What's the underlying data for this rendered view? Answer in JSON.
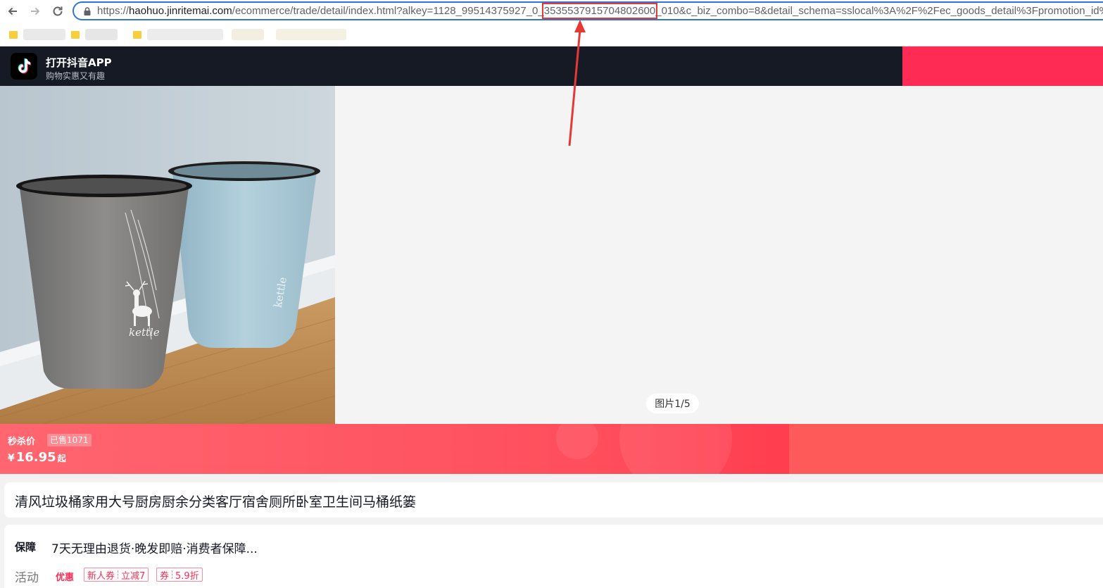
{
  "browser": {
    "url_prefix": "https://",
    "url_host": "haohuo.jinritemai.com",
    "url_path_before": "/ecommerce/trade/detail/index.html?alkey=1128_99514375927_0_",
    "url_highlight": "3535537915704802600",
    "url_path_after": "_010&c_biz_combo=8&detail_schema=sslocal%3A%2F%2Fec_goods_detail%3Fpromotion_id%"
  },
  "app_header": {
    "title": "打开抖音APP",
    "subtitle": "购物实惠又有趣"
  },
  "gallery": {
    "counter": "图片1/5",
    "product_image_text": "kettle"
  },
  "price_banner": {
    "label": "秒杀价",
    "sold": "已售1071",
    "currency": "¥",
    "price": "16.95",
    "suffix": "起"
  },
  "product": {
    "title": "清风垃圾桶家用大号厨房厨余分类客厅宿舍厕所卧室卫生间马桶纸篓"
  },
  "guarantee": {
    "label": "保障",
    "text": "7天无理由退货·晚发即赔·消费者保障..."
  },
  "activity": {
    "label": "活动",
    "tag": "优惠",
    "coupon1_a": "新人券",
    "coupon1_b": "立减7",
    "coupon2_a": "券",
    "coupon2_b": "5.9折"
  },
  "colors": {
    "accent": "#fe2c55",
    "header_bg": "#151a24",
    "banner": "#ff4d5c",
    "annotation": "#e53935"
  }
}
